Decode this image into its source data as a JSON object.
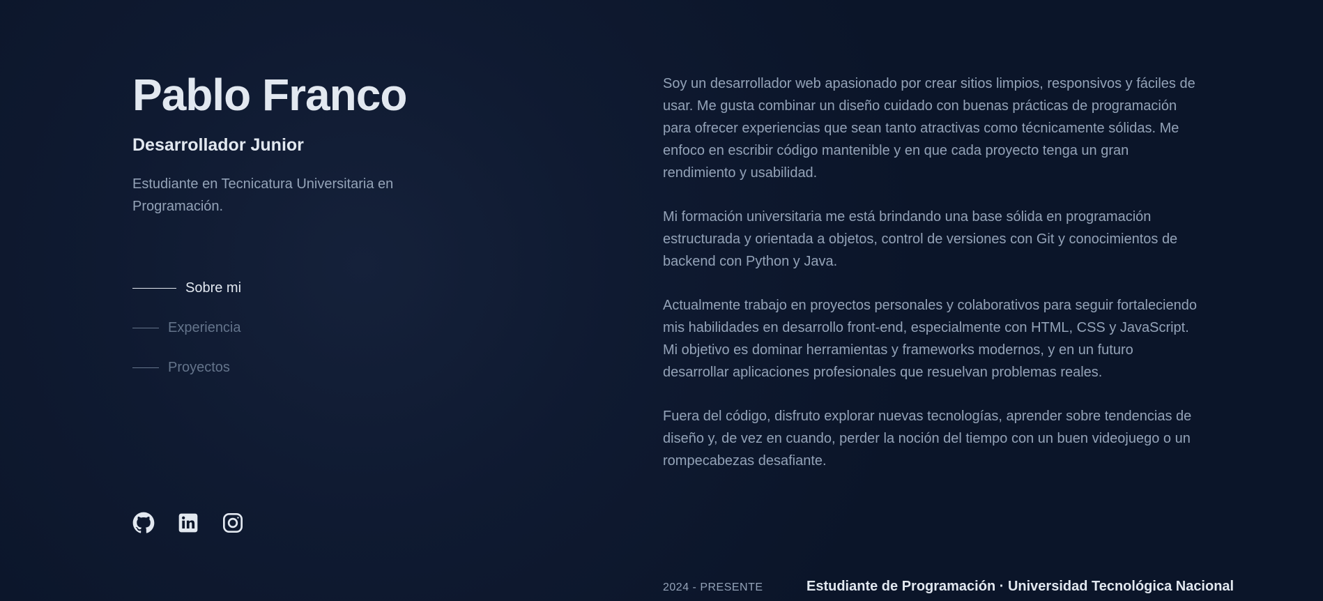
{
  "profile": {
    "name": "Pablo Franco",
    "role": "Desarrollador Junior",
    "tagline": "Estudiante en Tecnicatura Universitaria en Programación."
  },
  "nav": {
    "items": [
      {
        "label": "Sobre mi",
        "active": true
      },
      {
        "label": "Experiencia",
        "active": false
      },
      {
        "label": "Proyectos",
        "active": false
      }
    ]
  },
  "socials": {
    "items": [
      {
        "icon": "github-icon"
      },
      {
        "icon": "linkedin-icon"
      },
      {
        "icon": "instagram-icon"
      }
    ]
  },
  "about": {
    "paragraphs": [
      "Soy un desarrollador web apasionado por crear sitios limpios, responsivos y fáciles de usar. Me gusta combinar un diseño cuidado con buenas prácticas de programación para ofrecer experiencias que sean tanto atractivas como técnicamente sólidas. Me enfoco en escribir código mantenible y en que cada proyecto tenga un gran rendimiento y usabilidad.",
      "Mi formación universitaria me está brindando una base sólida en programación estructurada y orientada a objetos, control de versiones con Git y conocimientos de backend con Python y Java.",
      "Actualmente trabajo en proyectos personales y colaborativos para seguir fortaleciendo mis habilidades en desarrollo front-end, especialmente con HTML, CSS y JavaScript. Mi objetivo es dominar herramientas y frameworks modernos, y en un futuro desarrollar aplicaciones profesionales que resuelvan problemas reales.",
      "Fuera del código, disfruto explorar nuevas tecnologías, aprender sobre tendencias de diseño y, de vez en cuando, perder la noción del tiempo con un buen videojuego o un rompecabezas desafiante."
    ]
  },
  "experience": {
    "items": [
      {
        "date": "2024 - PRESENTE",
        "title": "Estudiante de Programación · Universidad Tecnológica Nacional"
      }
    ]
  },
  "colors": {
    "background": "#0b1529",
    "heading": "#e2e8f0",
    "body_text": "#94a3b8",
    "muted": "#64748b"
  }
}
